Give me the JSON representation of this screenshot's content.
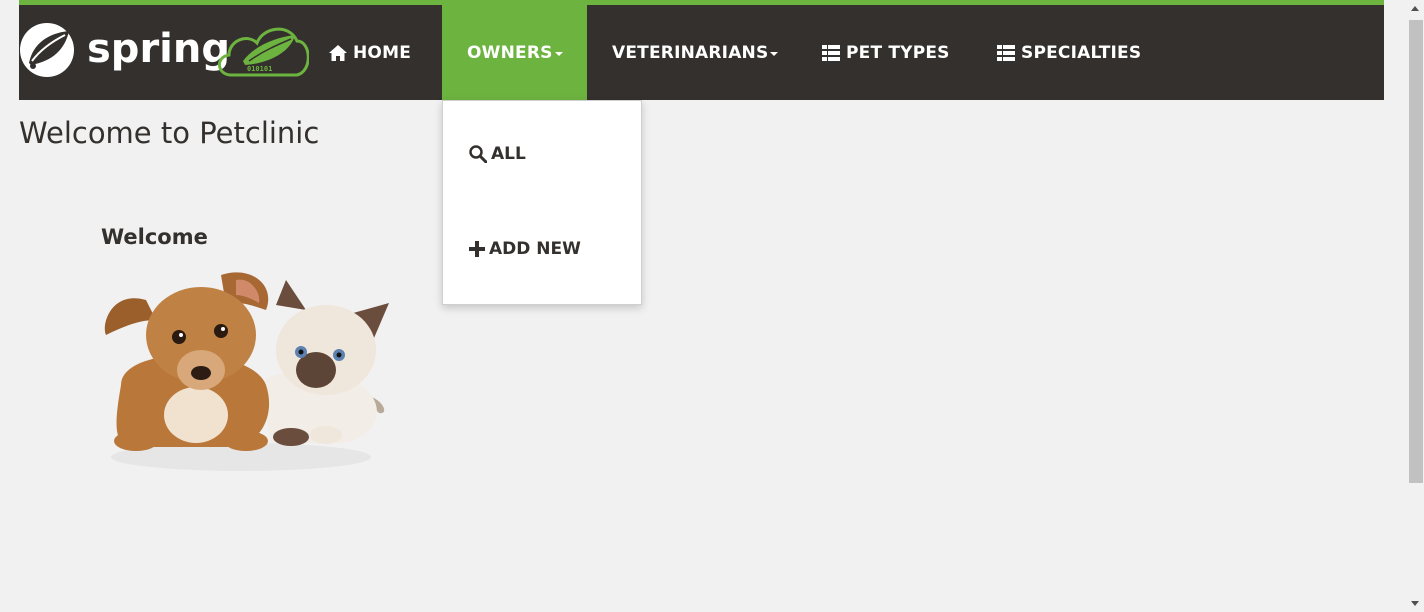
{
  "nav": {
    "brand_text": "spring",
    "brand_binary": "010101",
    "items": [
      {
        "label": "HOME",
        "icon": "home-icon"
      },
      {
        "label": "OWNERS",
        "icon": "",
        "dropdown": true,
        "active": true
      },
      {
        "label": "VETERINARIANS",
        "icon": "",
        "dropdown": true
      },
      {
        "label": "PET TYPES",
        "icon": "th-list-icon"
      },
      {
        "label": "SPECIALTIES",
        "icon": "th-list-icon"
      }
    ]
  },
  "owners_dropdown": {
    "items": [
      {
        "label": "ALL",
        "icon": "search-icon"
      },
      {
        "label": "ADD NEW",
        "icon": "plus-icon"
      }
    ]
  },
  "main": {
    "title": "Welcome to Petclinic",
    "welcome_heading": "Welcome",
    "image_icon": "pets-image"
  },
  "colors": {
    "accent": "#6db33f",
    "navbar_bg": "#34302d",
    "page_bg": "#f1f1f1",
    "text": "#34302d"
  }
}
